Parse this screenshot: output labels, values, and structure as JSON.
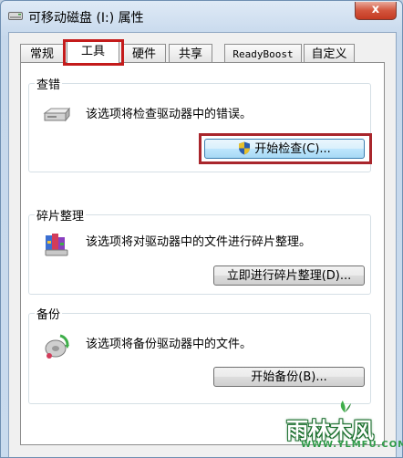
{
  "window": {
    "title": "可移动磁盘 (I:) 属性",
    "close_label": "x"
  },
  "tabs": [
    {
      "label": "常规",
      "active": false
    },
    {
      "label": "工具",
      "active": true
    },
    {
      "label": "硬件",
      "active": false
    },
    {
      "label": "共享",
      "active": false
    },
    {
      "label": "ReadyBoost",
      "active": false
    },
    {
      "label": "自定义",
      "active": false
    }
  ],
  "sections": {
    "error_check": {
      "title": "查错",
      "description": "该选项将检查驱动器中的错误。",
      "button_label": "开始检查(C)..."
    },
    "defrag": {
      "title": "碎片整理",
      "description": "该选项将对驱动器中的文件进行碎片整理。",
      "button_label": "立即进行碎片整理(D)..."
    },
    "backup": {
      "title": "备份",
      "description": "该选项将备份驱动器中的文件。",
      "button_label": "开始备份(B)..."
    }
  },
  "watermark": {
    "main": "雨林木风",
    "sub": "WWW.YLMFU.COM"
  },
  "colors": {
    "highlight_red": "#c41b1b",
    "watermark_green": "#2f9b48"
  }
}
